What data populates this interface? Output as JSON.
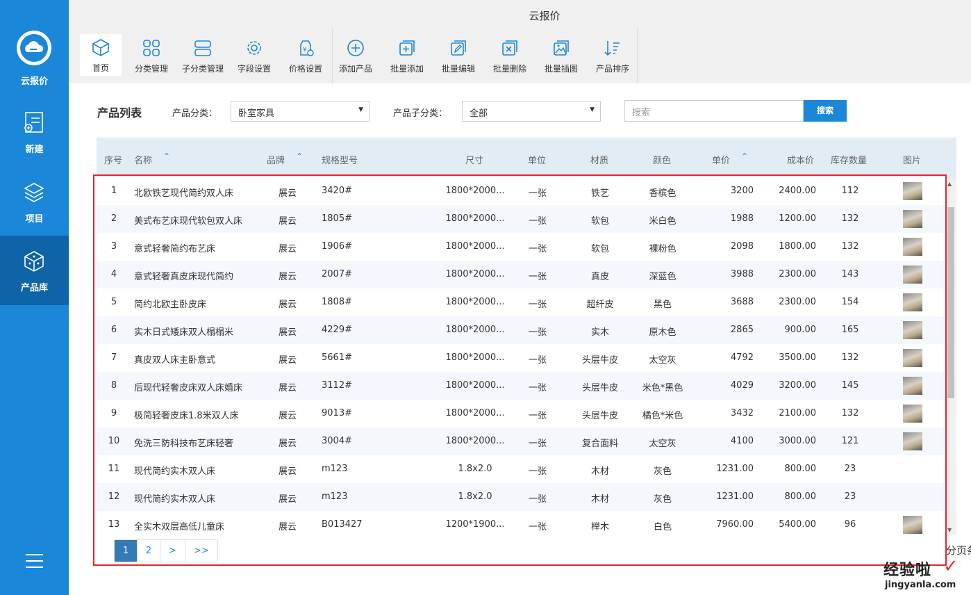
{
  "app": {
    "title": "云报价",
    "brand": "云报价"
  },
  "colors": {
    "primary": "#1a87d8",
    "sidebar_active": "#0f63a7",
    "highlight_box": "#e8232b"
  },
  "sidebar": {
    "items": [
      {
        "label": "新建",
        "icon": "new-document-icon"
      },
      {
        "label": "项目",
        "icon": "layers-icon"
      },
      {
        "label": "产品库",
        "icon": "cube-icon",
        "active": true
      }
    ],
    "menu_icon": "hamburger-menu-icon"
  },
  "toolbar": {
    "items": [
      {
        "label": "首页",
        "icon": "cube-icon"
      },
      {
        "label": "分类管理",
        "icon": "grid-icon"
      },
      {
        "label": "子分类管理",
        "icon": "sublist-icon"
      },
      {
        "label": "字段设置",
        "icon": "gear-icon"
      },
      {
        "label": "价格设置",
        "icon": "price-icon"
      },
      {
        "label": "添加产品",
        "icon": "plus-circle-icon"
      },
      {
        "label": "批量添加",
        "icon": "batch-add-icon"
      },
      {
        "label": "批量编辑",
        "icon": "batch-edit-icon"
      },
      {
        "label": "批量删除",
        "icon": "batch-delete-icon"
      },
      {
        "label": "批量插图",
        "icon": "batch-image-icon"
      },
      {
        "label": "产品排序",
        "icon": "sort-icon"
      }
    ]
  },
  "filters": {
    "list_title": "产品列表",
    "category_label": "产品分类：",
    "category_value": "卧室家具",
    "subcategory_label": "产品子分类：",
    "subcategory_value": "全部",
    "search_placeholder": "搜索",
    "search_button": "搜索"
  },
  "table": {
    "headers": {
      "index": "序号",
      "name": "名称",
      "brand": "品牌",
      "model": "规格型号",
      "size": "尺寸",
      "unit": "单位",
      "material": "材质",
      "color": "颜色",
      "price": "单价",
      "cost": "成本价",
      "stock": "库存数量",
      "image": "图片"
    },
    "rows": [
      {
        "index": "1",
        "name": "北欧铁艺现代简约双人床",
        "brand": "展云",
        "model": "3420#",
        "size": "1800*2000...",
        "unit": "一张",
        "material": "铁艺",
        "color": "香槟色",
        "price": "3200",
        "cost": "2400.00",
        "stock": "112",
        "has_image": true
      },
      {
        "index": "2",
        "name": "美式布艺床现代软包双人床",
        "brand": "展云",
        "model": "1805#",
        "size": "1800*2000...",
        "unit": "一张",
        "material": "软包",
        "color": "米白色",
        "price": "1988",
        "cost": "1200.00",
        "stock": "132",
        "has_image": true
      },
      {
        "index": "3",
        "name": "意式轻奢简约布艺床",
        "brand": "展云",
        "model": "1906#",
        "size": "1800*2000...",
        "unit": "一张",
        "material": "软包",
        "color": "裸粉色",
        "price": "2098",
        "cost": "1800.00",
        "stock": "132",
        "has_image": true
      },
      {
        "index": "4",
        "name": "意式轻奢真皮床现代简约",
        "brand": "展云",
        "model": "2007#",
        "size": "1800*2000...",
        "unit": "一张",
        "material": "真皮",
        "color": "深蓝色",
        "price": "3988",
        "cost": "2300.00",
        "stock": "143",
        "has_image": true
      },
      {
        "index": "5",
        "name": "简约北欧主卧皮床",
        "brand": "展云",
        "model": "1808#",
        "size": "1800*2000...",
        "unit": "一张",
        "material": "超纤皮",
        "color": "黑色",
        "price": "3688",
        "cost": "2300.00",
        "stock": "154",
        "has_image": true
      },
      {
        "index": "6",
        "name": "实木日式矮床双人榻榻米",
        "brand": "展云",
        "model": "4229#",
        "size": "1800*2000...",
        "unit": "一张",
        "material": "实木",
        "color": "原木色",
        "price": "2865",
        "cost": "900.00",
        "stock": "165",
        "has_image": true
      },
      {
        "index": "7",
        "name": "真皮双人床主卧意式",
        "brand": "展云",
        "model": "5661#",
        "size": "1800*2000...",
        "unit": "一张",
        "material": "头层牛皮",
        "color": "太空灰",
        "price": "4792",
        "cost": "3500.00",
        "stock": "132",
        "has_image": true
      },
      {
        "index": "8",
        "name": "后现代轻奢皮床双人床婚床",
        "brand": "展云",
        "model": "3112#",
        "size": "1800*2000...",
        "unit": "一张",
        "material": "头层牛皮",
        "color": "米色*黑色",
        "price": "4029",
        "cost": "3200.00",
        "stock": "145",
        "has_image": true
      },
      {
        "index": "9",
        "name": "极简轻奢皮床1.8米双人床",
        "brand": "展云",
        "model": "9013#",
        "size": "1800*2000...",
        "unit": "一张",
        "material": "头层牛皮",
        "color": "橘色*米色",
        "price": "3432",
        "cost": "2100.00",
        "stock": "132",
        "has_image": true
      },
      {
        "index": "10",
        "name": "免洗三防科技布艺床轻奢",
        "brand": "展云",
        "model": "3004#",
        "size": "1800*2000...",
        "unit": "一张",
        "material": "复合面料",
        "color": "太空灰",
        "price": "4100",
        "cost": "3000.00",
        "stock": "121",
        "has_image": true
      },
      {
        "index": "11",
        "name": "现代简约实木双人床",
        "brand": "展云",
        "model": "m123",
        "size": "1.8x2.0",
        "unit": "一张",
        "material": "木材",
        "color": "灰色",
        "price": "1231.00",
        "cost": "800.00",
        "stock": "23",
        "has_image": false
      },
      {
        "index": "12",
        "name": "现代简约实木双人床",
        "brand": "展云",
        "model": "m123",
        "size": "1.8x2.0",
        "unit": "一张",
        "material": "木材",
        "color": "灰色",
        "price": "1231.00",
        "cost": "800.00",
        "stock": "23",
        "has_image": false
      },
      {
        "index": "13",
        "name": "全实木双层高低儿童床",
        "brand": "展云",
        "model": "B013427",
        "size": "1200*1900...",
        "unit": "一张",
        "material": "榉木",
        "color": "白色",
        "price": "7960.00",
        "cost": "5400.00",
        "stock": "96",
        "has_image": true
      }
    ]
  },
  "pagination": {
    "pages": [
      "1",
      "2",
      ">",
      ">>"
    ],
    "current": "1",
    "note": "分页条"
  },
  "watermark": {
    "line1": "经验啦",
    "check": "✓",
    "line2": "jingyanla.com"
  }
}
